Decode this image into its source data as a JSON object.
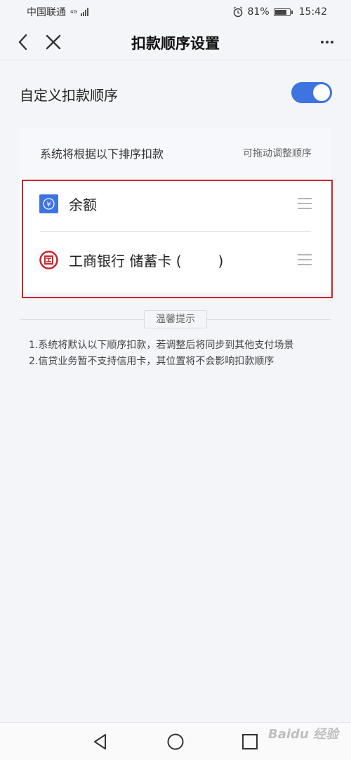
{
  "status_bar": {
    "carrier": "中国联通",
    "network": "4G",
    "battery_percent": "81%",
    "time": "15:42",
    "icons": [
      "signal-icon",
      "alarm-icon",
      "battery-icon"
    ]
  },
  "header": {
    "title": "扣款顺序设置",
    "icons": [
      "back-icon",
      "close-icon",
      "more-icon"
    ]
  },
  "custom_order": {
    "label": "自定义扣款顺序",
    "enabled": true
  },
  "order_card": {
    "title": "系统将根据以下排序扣款",
    "hint": "可拖动调整顺序",
    "items": [
      {
        "label": "余额",
        "icon": "balance-icon"
      },
      {
        "label": "工商银行 储蓄卡 (",
        "label_suffix": ")",
        "icon": "icbc-icon"
      }
    ]
  },
  "tips": {
    "title": "温馨提示",
    "lines": [
      "1.系统将默认以下顺序扣款，若调整后将同步到其他支付场景",
      "2.信贷业务暂不支持信用卡，其位置将不会影响扣款顺序"
    ]
  },
  "watermark": "Baidu 经验",
  "colors": {
    "accent": "#3e74e0",
    "highlight": "#c9252c",
    "icbc": "#c6282e"
  }
}
